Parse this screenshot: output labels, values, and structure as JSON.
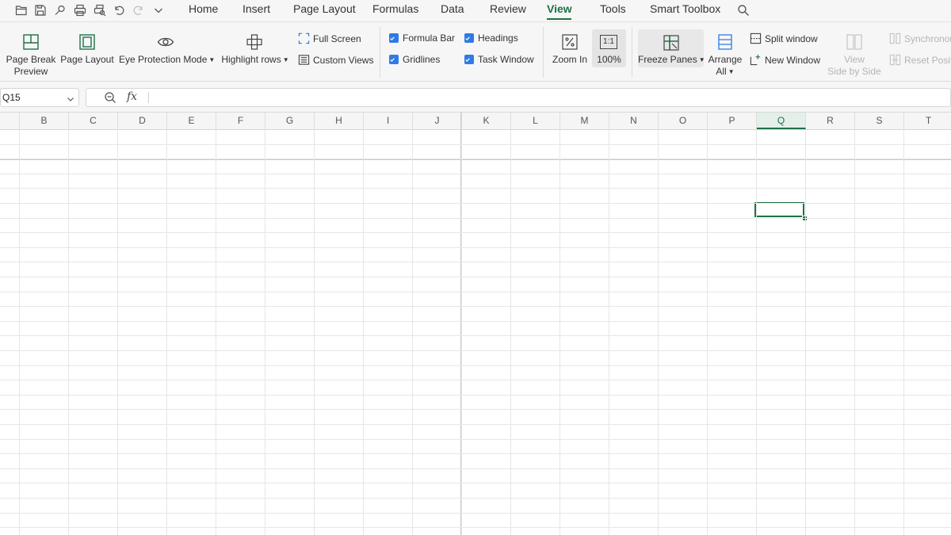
{
  "quick_access": {
    "icons": [
      "folder-open-icon",
      "save-icon",
      "cloud-save-icon",
      "print-icon",
      "print-preview-icon",
      "undo-icon",
      "redo-icon",
      "customize-chevron-icon"
    ]
  },
  "menu_tabs": [
    "Home",
    "Insert",
    "Page Layout",
    "Formulas",
    "Data",
    "Review",
    "View",
    "Tools",
    "Smart Toolbox"
  ],
  "active_tab": "View",
  "accent_color": "#1e7145",
  "ribbon": {
    "page_break_preview": [
      "Page Break",
      "Preview"
    ],
    "page_layout": "Page Layout",
    "eye_protection": "Eye Protection Mode",
    "highlight_rows": "Highlight rows",
    "full_screen": "Full Screen",
    "custom_views": "Custom Views",
    "formula_bar": "Formula Bar",
    "gridlines": "Gridlines",
    "headings": "Headings",
    "task_window": "Task Window",
    "zoom_in": "Zoom In",
    "zoom_100": "100%",
    "zoom_100_icon_text": "1:1",
    "freeze_panes": "Freeze Panes",
    "arrange_all": [
      "Arrange",
      "All"
    ],
    "split_window": "Split window",
    "new_window": "New Window",
    "view_side_by_side": [
      "View",
      "Side by Side"
    ],
    "synchronous": "Synchronou",
    "reset_position": "Reset Positi"
  },
  "checkboxes": {
    "formula_bar": true,
    "gridlines": true,
    "headings": true,
    "task_window": true
  },
  "name_box": "Q15",
  "formula_content": "",
  "fx_label": "fx",
  "columns": [
    "B",
    "C",
    "D",
    "E",
    "F",
    "G",
    "H",
    "I",
    "J",
    "K",
    "L",
    "M",
    "N",
    "O",
    "P",
    "Q",
    "R",
    "S",
    "T"
  ],
  "selected_column": "Q",
  "selected_cell": "Q15"
}
